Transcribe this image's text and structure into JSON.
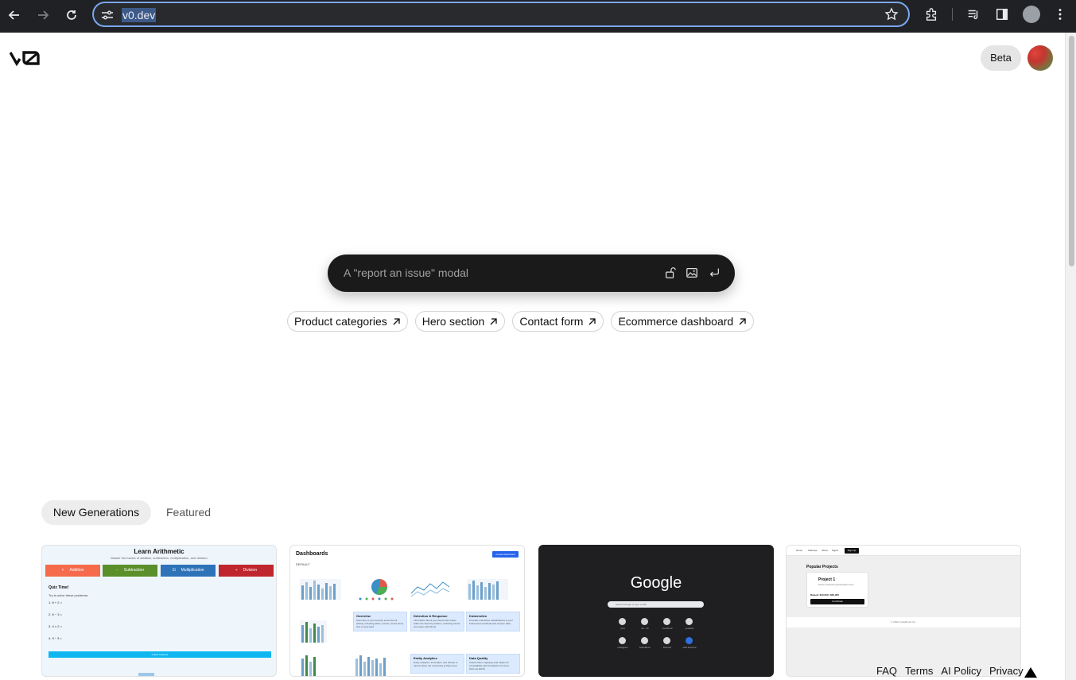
{
  "browser": {
    "url": "v0.dev",
    "icons": [
      "back-icon",
      "forward-icon",
      "reload-icon",
      "tune-icon",
      "star-icon",
      "extensions-icon",
      "media-icon",
      "sidebar-icon",
      "profile-icon",
      "menu-icon"
    ]
  },
  "header": {
    "logo": "v0",
    "beta_label": "Beta"
  },
  "prompt": {
    "placeholder": "A \"report an issue\" modal",
    "icons": [
      "unlock-icon",
      "image-icon",
      "enter-icon"
    ]
  },
  "suggestions": [
    {
      "label": "Product categories"
    },
    {
      "label": "Hero section"
    },
    {
      "label": "Contact form"
    },
    {
      "label": "Ecommerce dashboard"
    }
  ],
  "tabs": {
    "new_generations": "New Generations",
    "featured": "Featured"
  },
  "cards": {
    "arithmetic": {
      "title": "Learn Arithmetic",
      "subtitle": "Master the basics of addition, subtraction, multiplication, and division",
      "ops": [
        {
          "sym": "+",
          "label": "Addition",
          "color": "#f56b4c"
        },
        {
          "sym": "−",
          "label": "Subtraction",
          "color": "#5a8f2a"
        },
        {
          "sym": "⊡",
          "label": "Multiplication",
          "color": "#2e73b8"
        },
        {
          "sym": "÷",
          "label": "Division",
          "color": "#c0262d"
        }
      ],
      "quiz_title": "Quiz Time!",
      "quiz_sub": "Try to solve these problems:",
      "problems": [
        "1. 8 + 2 =",
        "2. 6 − 3 =",
        "3. 4 × 2 =",
        "4. 9 ÷ 3 ="
      ],
      "button": "Check Answers"
    },
    "dashboards": {
      "title": "Dashboards",
      "button": "Create Dashboard",
      "section": "DEFAULT",
      "panels": [
        {
          "title": "Overview",
          "desc": "Summary of your security environment activity, including alerts, events, recent items, and a news feed"
        },
        {
          "title": "Detection & Response",
          "desc": "Information about your Alerts and Cases within the Security solution, including trends and cases with Alerts"
        },
        {
          "title": "Kubernetes",
          "desc": "Provides interactive visualizations of your Kubernetes workload and session data"
        },
        {
          "title": "Entity Analytics",
          "desc": "Entity analytics, anomalies, and threats to narrow down the monitoring surface area"
        },
        {
          "title": "Data Quality",
          "desc": "Check index mappings and values for compatibility with the Elastic Common Schema (ECS)"
        }
      ]
    },
    "google": {
      "logo": "Google",
      "search_placeholder": "Search Google or type a URL",
      "shortcuts": [
        "(no)",
        "ub...sh",
        "roomfront",
        "youtube",
        "instagram",
        "Televideon",
        "Discord",
        "Add shortcut"
      ]
    },
    "projects": {
      "nav": [
        "Home",
        "Startups",
        "About",
        "Signin"
      ],
      "signup": "Sign Up",
      "title": "Popular Projects",
      "project_title": "Project 1",
      "project_desc": "Some interesting description here",
      "raised": "Raised: $10,000 / $20,000",
      "contribute": "Contribute",
      "footer": "© 2024 CrowdFund Inc."
    }
  },
  "footer": {
    "links": [
      "FAQ",
      "Terms",
      "AI Policy",
      "Privacy"
    ]
  }
}
